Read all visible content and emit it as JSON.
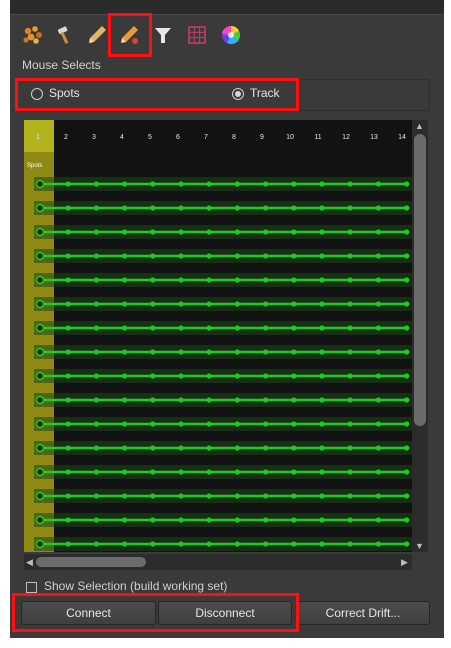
{
  "toolbar": {
    "icons": [
      "particles-icon",
      "hammer-icon",
      "pencil-icon",
      "edit-track-icon",
      "filter-icon",
      "grid-icon",
      "color-wheel-icon"
    ],
    "active_icon": "edit-track-icon"
  },
  "mouse_selects": {
    "label": "Mouse Selects",
    "spots_label": "Spots",
    "track_label": "Track",
    "selected": "Track"
  },
  "track_grid": {
    "frames": [
      "1",
      "2",
      "3",
      "4",
      "5",
      "6",
      "7",
      "8",
      "9",
      "10",
      "11",
      "12",
      "13",
      "14"
    ],
    "selected_frame": "1",
    "row_label": "Spots",
    "track_count": 16,
    "track_color": "#1ecb1e",
    "highlight_color": "#b3b31e"
  },
  "show_selection": {
    "label": "Show Selection (build working set)",
    "checked": false
  },
  "buttons": {
    "connect": "Connect",
    "disconnect": "Disconnect",
    "correct_drift": "Correct Drift..."
  },
  "colors": {
    "panel_bg": "#3a3a3a",
    "annotation_red": "#ff1010"
  }
}
